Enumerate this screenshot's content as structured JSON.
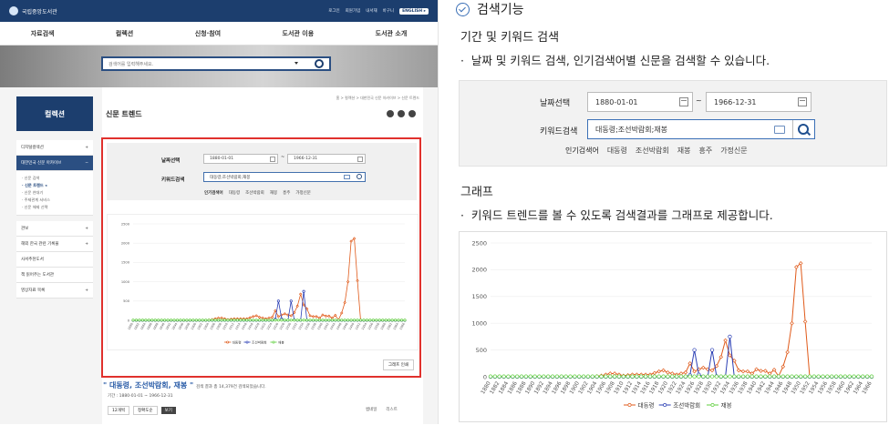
{
  "site": {
    "logo": "국립중앙도서관",
    "util": [
      "로그인",
      "회원가입",
      "내서재",
      "바구니",
      "ENGLISH ▸"
    ],
    "gnb": [
      "자료검색",
      "컬렉션",
      "신청·참여",
      "도서관 이용",
      "도서관 소개"
    ],
    "hero_placeholder": "검색어를 입력해주세요.",
    "side_title": "컬렉션",
    "side_items": [
      "디지털컬렉션",
      "대한민국 신문 아카이브",
      "관보",
      "해외 한국 관련 기록물",
      "사서추천도서",
      "책 읽어주는 도서관",
      "영상자료 목록"
    ],
    "side_sub": [
      "신문 검색",
      "신문 트렌드",
      "신문 연대기",
      "주제관계 서비스",
      "신문 해제 선택"
    ],
    "page_title": "신문 트렌드",
    "breadcrumb": "홈  >  컬렉션  >  대한민국 신문 아카이브  >  신문 트렌드",
    "small_date_label": "날짜선택",
    "small_kw_label": "키워드검색",
    "small_from": "1880-01-01",
    "small_to": "1966-12-31",
    "small_kw": "대동령;조선박람회;재봉",
    "small_pop": [
      "인기검색어",
      "대동령",
      "조선박람회",
      "재봉",
      "흥주",
      "가정신문"
    ],
    "print_btn": "그래프 인쇄",
    "kw_result": "\" 대동령, 조선박람회, 재봉 \"",
    "kw_result_suffix": "검색 결과 총 14,379건 검색되었습니다.",
    "period": "기간 : 1880-01-01 ~ 1966-12-31",
    "ctrl": [
      "12개씩",
      "정확도순",
      "보기"
    ],
    "view_toggle": [
      "썸네일",
      "리스트"
    ]
  },
  "doc": {
    "title": "검색기능",
    "section1": "기간 및 키워드 검색",
    "bullet1": "날짜 및 키워드 검색, 인기검색어별 신문을 검색할 수 있습니다.",
    "section2": "그래프",
    "bullet2": "키워드 트렌드를 볼 수 있도록 검색결과를 그래프로 제공합니다."
  },
  "filter": {
    "date_label": "날짜선택",
    "date_from": "1880-01-01",
    "tilde": "~",
    "date_to": "1966-12-31",
    "kw_label": "키워드검색",
    "kw_value": "대동령;조선박람회;재봉",
    "popular_label": "인기검색어",
    "popular": [
      "대동령",
      "조선박람회",
      "재봉",
      "흥주",
      "가정신문"
    ]
  },
  "chart_data": {
    "type": "line",
    "yticks": [
      0,
      500,
      1000,
      1500,
      2000,
      2500
    ],
    "ylim": [
      0,
      2500
    ],
    "x": [
      1880,
      1881,
      1882,
      1883,
      1884,
      1885,
      1886,
      1887,
      1888,
      1889,
      1890,
      1891,
      1892,
      1893,
      1894,
      1895,
      1896,
      1897,
      1898,
      1899,
      1900,
      1901,
      1902,
      1903,
      1904,
      1905,
      1906,
      1907,
      1908,
      1909,
      1910,
      1911,
      1912,
      1913,
      1914,
      1915,
      1916,
      1917,
      1918,
      1919,
      1920,
      1921,
      1922,
      1923,
      1924,
      1925,
      1926,
      1927,
      1928,
      1929,
      1930,
      1931,
      1932,
      1933,
      1934,
      1935,
      1936,
      1937,
      1938,
      1939,
      1940,
      1941,
      1942,
      1943,
      1944,
      1945,
      1946,
      1947,
      1948,
      1949,
      1950,
      1951,
      1952,
      1953,
      1954,
      1955,
      1956,
      1957,
      1958,
      1959,
      1960,
      1961,
      1962,
      1963,
      1964,
      1965,
      1966
    ],
    "xticks": [
      1880,
      1882,
      1884,
      1886,
      1888,
      1890,
      1892,
      1894,
      1896,
      1898,
      1900,
      1902,
      1904,
      1906,
      1908,
      1910,
      1912,
      1914,
      1916,
      1918,
      1920,
      1922,
      1924,
      1926,
      1928,
      1930,
      1932,
      1934,
      1936,
      1938,
      1940,
      1942,
      1944,
      1946,
      1948,
      1950,
      1952,
      1954,
      1956,
      1958,
      1960,
      1962,
      1964,
      1966
    ],
    "series": [
      {
        "name": "대동령",
        "color": "#e05a1a",
        "marker": "diamond",
        "values": [
          0,
          0,
          0,
          0,
          0,
          0,
          0,
          0,
          0,
          0,
          0,
          0,
          0,
          0,
          0,
          0,
          0,
          0,
          0,
          0,
          0,
          0,
          0,
          0,
          10,
          20,
          40,
          60,
          60,
          40,
          20,
          30,
          40,
          40,
          40,
          40,
          40,
          70,
          100,
          120,
          80,
          60,
          40,
          60,
          80,
          250,
          100,
          140,
          170,
          140,
          120,
          200,
          370,
          680,
          400,
          300,
          120,
          100,
          100,
          60,
          140,
          110,
          110,
          60,
          130,
          10,
          190,
          460,
          1000,
          2050,
          2120,
          1030,
          0,
          0,
          0,
          0,
          0,
          0,
          0,
          0,
          0,
          0,
          0,
          0,
          0,
          0,
          0
        ]
      },
      {
        "name": "조선박람회",
        "color": "#2b3fb5",
        "marker": "circle",
        "values": [
          0,
          0,
          0,
          0,
          0,
          0,
          0,
          0,
          0,
          0,
          0,
          0,
          0,
          0,
          0,
          0,
          0,
          0,
          0,
          0,
          0,
          0,
          0,
          0,
          0,
          0,
          0,
          0,
          0,
          0,
          0,
          0,
          0,
          0,
          0,
          0,
          0,
          0,
          0,
          0,
          0,
          0,
          0,
          0,
          0,
          30,
          500,
          40,
          0,
          0,
          500,
          10,
          0,
          0,
          750,
          0,
          0,
          0,
          0,
          0,
          0,
          0,
          0,
          0,
          0,
          0,
          0,
          0,
          0,
          0,
          0,
          0,
          0,
          0,
          0,
          0,
          0,
          0,
          0,
          0,
          0,
          0,
          0,
          0,
          0,
          0,
          0
        ]
      },
      {
        "name": "재봉",
        "color": "#5fcf3e",
        "marker": "circle",
        "values": [
          5,
          5,
          5,
          5,
          5,
          5,
          5,
          5,
          5,
          5,
          5,
          5,
          5,
          5,
          5,
          5,
          5,
          5,
          5,
          5,
          5,
          5,
          5,
          5,
          5,
          5,
          5,
          5,
          5,
          5,
          5,
          5,
          5,
          5,
          5,
          5,
          5,
          5,
          5,
          5,
          5,
          5,
          5,
          5,
          5,
          5,
          5,
          5,
          5,
          5,
          5,
          5,
          5,
          5,
          5,
          5,
          5,
          5,
          5,
          5,
          5,
          5,
          5,
          5,
          5,
          5,
          5,
          5,
          5,
          5,
          5,
          5,
          5,
          5,
          5,
          5,
          5,
          5,
          5,
          5,
          5,
          5,
          5,
          5,
          5,
          5,
          5
        ]
      }
    ],
    "legend_position": "bottom-center"
  }
}
